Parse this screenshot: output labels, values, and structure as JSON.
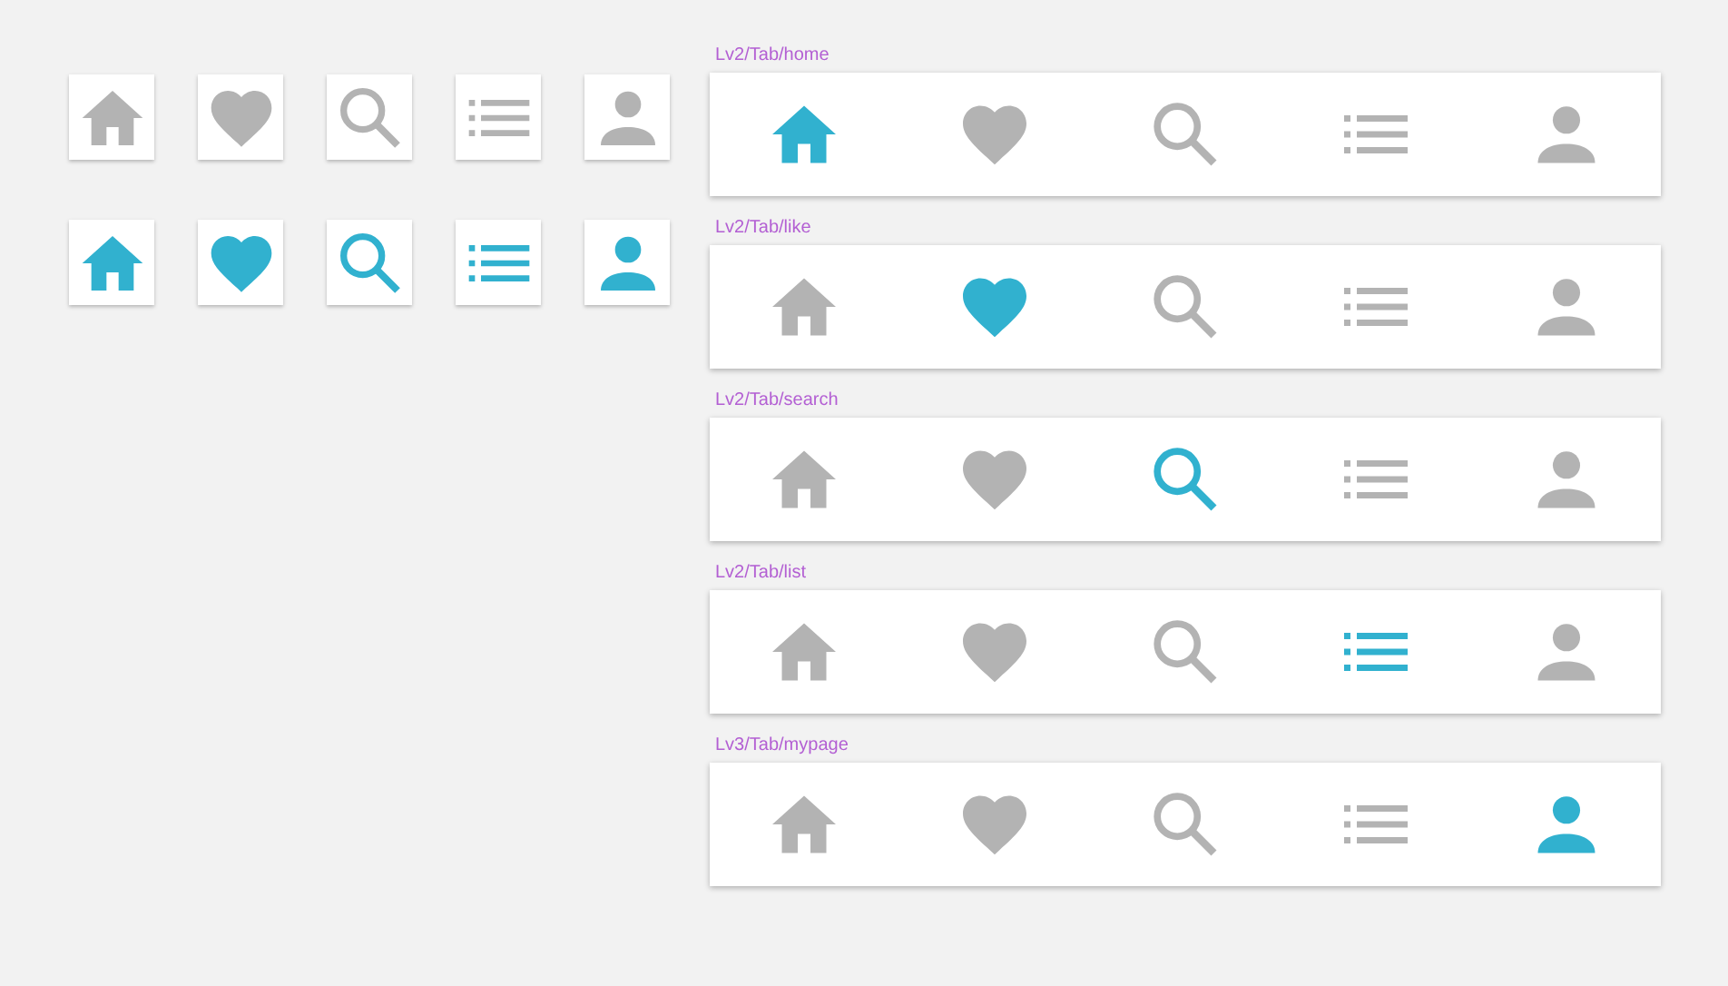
{
  "icon_rows": [
    {
      "icons": [
        {
          "kind": "home",
          "selected": false
        },
        {
          "kind": "heart",
          "selected": false
        },
        {
          "kind": "search",
          "selected": false
        },
        {
          "kind": "list",
          "selected": false
        },
        {
          "kind": "person",
          "selected": false
        }
      ]
    },
    {
      "icons": [
        {
          "kind": "home",
          "selected": true
        },
        {
          "kind": "heart",
          "selected": true
        },
        {
          "kind": "search",
          "selected": true
        },
        {
          "kind": "list",
          "selected": true
        },
        {
          "kind": "person",
          "selected": true
        }
      ]
    }
  ],
  "tab_bars": [
    {
      "label": "Lv2/Tab/home",
      "tabs": [
        {
          "kind": "home",
          "selected": true
        },
        {
          "kind": "heart",
          "selected": false
        },
        {
          "kind": "search",
          "selected": false
        },
        {
          "kind": "list",
          "selected": false
        },
        {
          "kind": "person",
          "selected": false
        }
      ]
    },
    {
      "label": "Lv2/Tab/like",
      "tabs": [
        {
          "kind": "home",
          "selected": false
        },
        {
          "kind": "heart",
          "selected": true
        },
        {
          "kind": "search",
          "selected": false
        },
        {
          "kind": "list",
          "selected": false
        },
        {
          "kind": "person",
          "selected": false
        }
      ]
    },
    {
      "label": "Lv2/Tab/search",
      "tabs": [
        {
          "kind": "home",
          "selected": false
        },
        {
          "kind": "heart",
          "selected": false
        },
        {
          "kind": "search",
          "selected": true
        },
        {
          "kind": "list",
          "selected": false
        },
        {
          "kind": "person",
          "selected": false
        }
      ]
    },
    {
      "label": "Lv2/Tab/list",
      "tabs": [
        {
          "kind": "home",
          "selected": false
        },
        {
          "kind": "heart",
          "selected": false
        },
        {
          "kind": "search",
          "selected": false
        },
        {
          "kind": "list",
          "selected": true
        },
        {
          "kind": "person",
          "selected": false
        }
      ]
    },
    {
      "label": "Lv3/Tab/mypage",
      "tabs": [
        {
          "kind": "home",
          "selected": false
        },
        {
          "kind": "heart",
          "selected": false
        },
        {
          "kind": "search",
          "selected": false
        },
        {
          "kind": "list",
          "selected": false
        },
        {
          "kind": "person",
          "selected": true
        }
      ]
    }
  ]
}
